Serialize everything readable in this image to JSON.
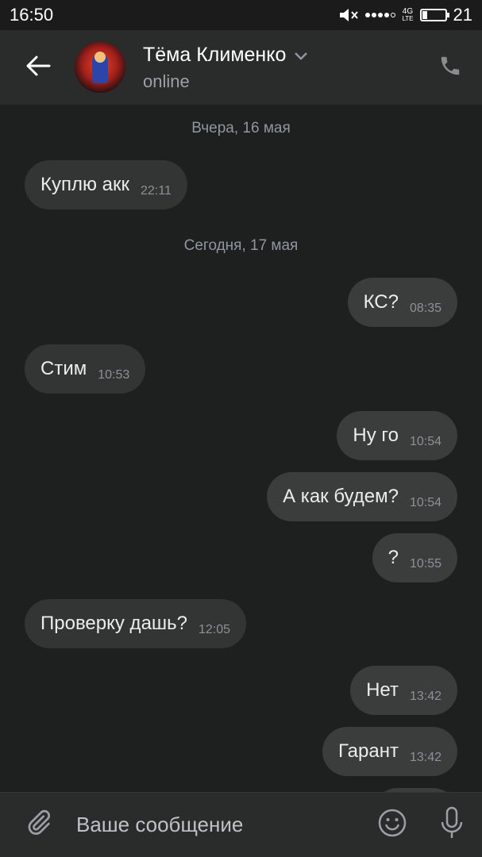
{
  "statusbar": {
    "time": "16:50",
    "network": "4G\nLTE",
    "battery_text": "21",
    "battery_level_percent": 21
  },
  "header": {
    "contact_name": "Тёма Клименко",
    "contact_status": "online",
    "icons": [
      "back-arrow-icon",
      "chevron-down-icon",
      "phone-icon"
    ]
  },
  "messages": {
    "date_yesterday": "Вчера, 16 мая",
    "date_today": "Сегодня, 17 мая",
    "items": [
      {
        "text": "Куплю акк",
        "time": "22:11",
        "direction": "in"
      },
      {
        "text": "КС?",
        "time": "08:35",
        "direction": "out"
      },
      {
        "text": "Стим",
        "time": "10:53",
        "direction": "in"
      },
      {
        "text": "Ну го",
        "time": "10:54",
        "direction": "out"
      },
      {
        "text": "А как будем?",
        "time": "10:54",
        "direction": "out"
      },
      {
        "text": "?",
        "time": "10:55",
        "direction": "out"
      },
      {
        "text": "Проверку дашь?",
        "time": "12:05",
        "direction": "in"
      },
      {
        "text": "Нет",
        "time": "13:42",
        "direction": "out"
      },
      {
        "text": "Гарант",
        "time": "13:42",
        "direction": "out"
      }
    ]
  },
  "composer": {
    "placeholder": "Ваше сообщение",
    "icons": [
      "paperclip-icon",
      "smiley-icon",
      "microphone-icon"
    ]
  },
  "colors": {
    "background": "#1e1f1f",
    "header": "#2a2b2b",
    "bubble_in": "#333434",
    "bubble_out": "#3b3c3c",
    "date_text": "#8f979e"
  }
}
